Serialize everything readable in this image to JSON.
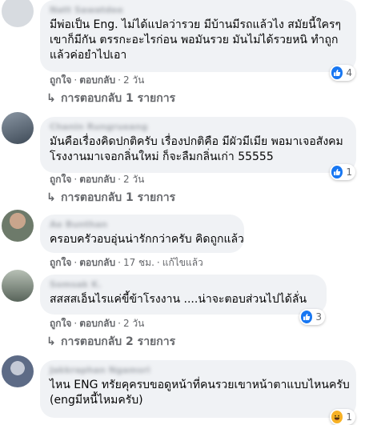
{
  "labels": {
    "like": "ถูกใจ",
    "reply": "ตอบกลับ",
    "separator": "·"
  },
  "colors": {
    "bubble": "#f0f2f5",
    "meta": "#65676b",
    "like_blue": "#1877f2",
    "haha_yellow": "#f7b125"
  },
  "comments": [
    {
      "author": "Natt Sawatdee",
      "lines": [
        "มีพ่อเป็น Eng. ไม่ได้แปลว่ารวย มีบ้านมีรถแล้วไง สมัยนี้ใครๆ",
        "เขาก็มีกัน ตรรกะอะไรก่อน พอมันรวย มันไม่ได้รวยหนิ ทำถูก",
        "แล้วค่อยําไปเอา"
      ],
      "time": "2 วัน",
      "reaction": {
        "icon": "like-icon",
        "count": "4"
      },
      "replies": "การตอบกลับ 1 รายการ"
    },
    {
      "author": "Chanin Rungrueang",
      "lines": [
        "มันคือเรื่องคิดปกติครับ เรื่องปกติคือ มีผัวมีเมีย พอมาเจอสังคม",
        "โรงงานมาเจอกลิ่นใหม่ ก็จะลืมกลิ่นเก่า 55555"
      ],
      "time": "2 วัน",
      "reaction": {
        "icon": "like-icon",
        "count": "1"
      },
      "replies": "การตอบกลับ 1 รายการ"
    },
    {
      "author": "Ae Bunthan",
      "lines": [
        "ครอบครัวอบอุ่นน่ารักกว่าครับ คิดถูกแล้ว"
      ],
      "time": "17 ชม.",
      "edited": "แก้ไขแล้ว"
    },
    {
      "author": "Somsak K.",
      "lines": [
        "สสสสเอ็นไรแค่ขี้ข้าโรงงาน ....น่าจะตอบส่วนไปได้ลั่น"
      ],
      "time": "2 วัน",
      "reaction": {
        "icon": "like-icon",
        "count": "3"
      },
      "replies": "การตอบกลับ 2 รายการ"
    },
    {
      "author": "Jakkraphan Ngamsri",
      "lines": [
        "ไหน ENG ทรัยคุครบขอดูหน้าที่คนรวยเขาหน้าตาแบบไหนครับ",
        "(engมีหนี้ไหมครับ)"
      ],
      "reaction": {
        "icon": "haha-icon",
        "count": "1"
      }
    }
  ]
}
